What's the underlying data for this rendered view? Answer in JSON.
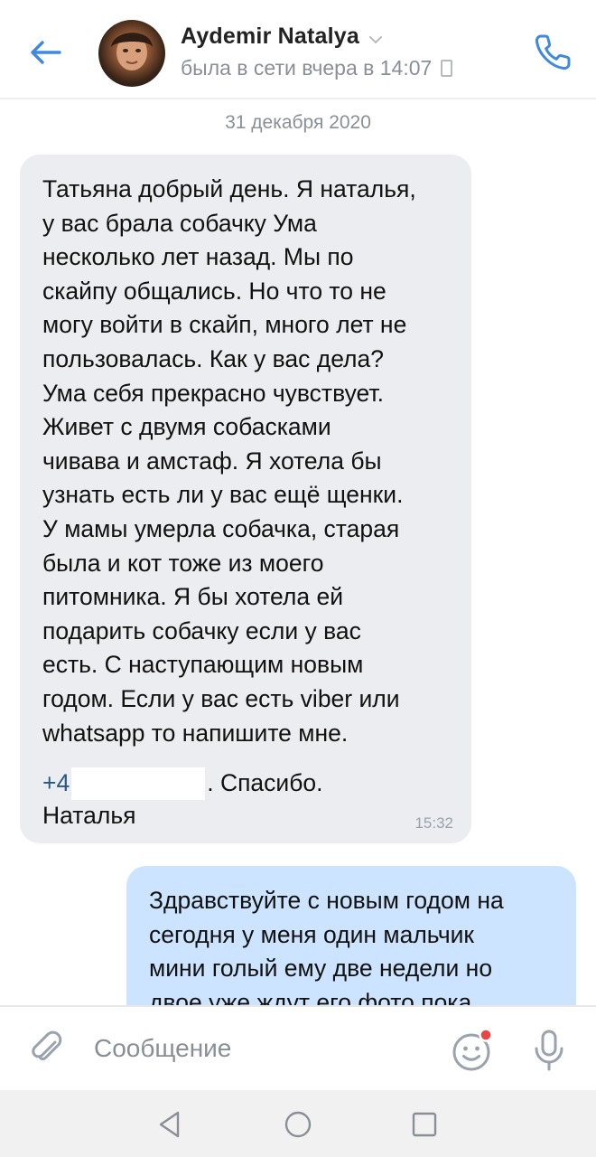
{
  "header": {
    "contact_name": "Aydemir Natalya",
    "status": "была в сети вчера в 14:07",
    "icons": {
      "back": "arrow-left-icon",
      "chevron": "chevron-down-icon",
      "device": "mobile-device-icon",
      "call": "phone-icon"
    },
    "accent_color": "#3f8ae0"
  },
  "date_separator": "31 декабря 2020",
  "messages": [
    {
      "direction": "incoming",
      "text": "Татьяна добрый день. Я наталья,\nу вас брала собачку Ума\nнесколько лет назад. Мы по\nскайпу общались. Но что то не\nмогу войти в скайп, много лет не\nпользовалась. Как у вас дела?\nУма себя прекрасно чувствует.\nЖивет с двумя собасками\nчивава и амстаф. Я хотела бы\nузнать есть ли у вас ещё щенки.\nУ мамы умерла собачка, старая\nбыла и кот тоже из моего\nпитомника. Я бы хотела ей\nподарить собачку если у вас\nесть. С наступающим новым\nгодом. Если у вас есть viber или\nwhatsapp то напишите мне.",
      "phone_prefix": "+4",
      "after_phone": ". Спасибо.",
      "signature": "Наталья",
      "time": "15:32",
      "bubble_color": "#ebedf0"
    },
    {
      "direction": "outgoing",
      "text": "Здравствуйте с новым годом  на\nсегодня у меня один мальчик\nмини  голый ему две недели  но\nдвое уже ждут его фото  пока",
      "bubble_color": "#cce4ff"
    }
  ],
  "composer": {
    "placeholder": "Сообщение",
    "icons": {
      "attach": "paperclip-icon",
      "emoji": "smiley-icon",
      "mic": "microphone-icon"
    },
    "notification_dot_color": "#e64646"
  },
  "system_nav": {
    "icons": [
      "nav-back-icon",
      "nav-home-icon",
      "nav-recents-icon"
    ]
  }
}
